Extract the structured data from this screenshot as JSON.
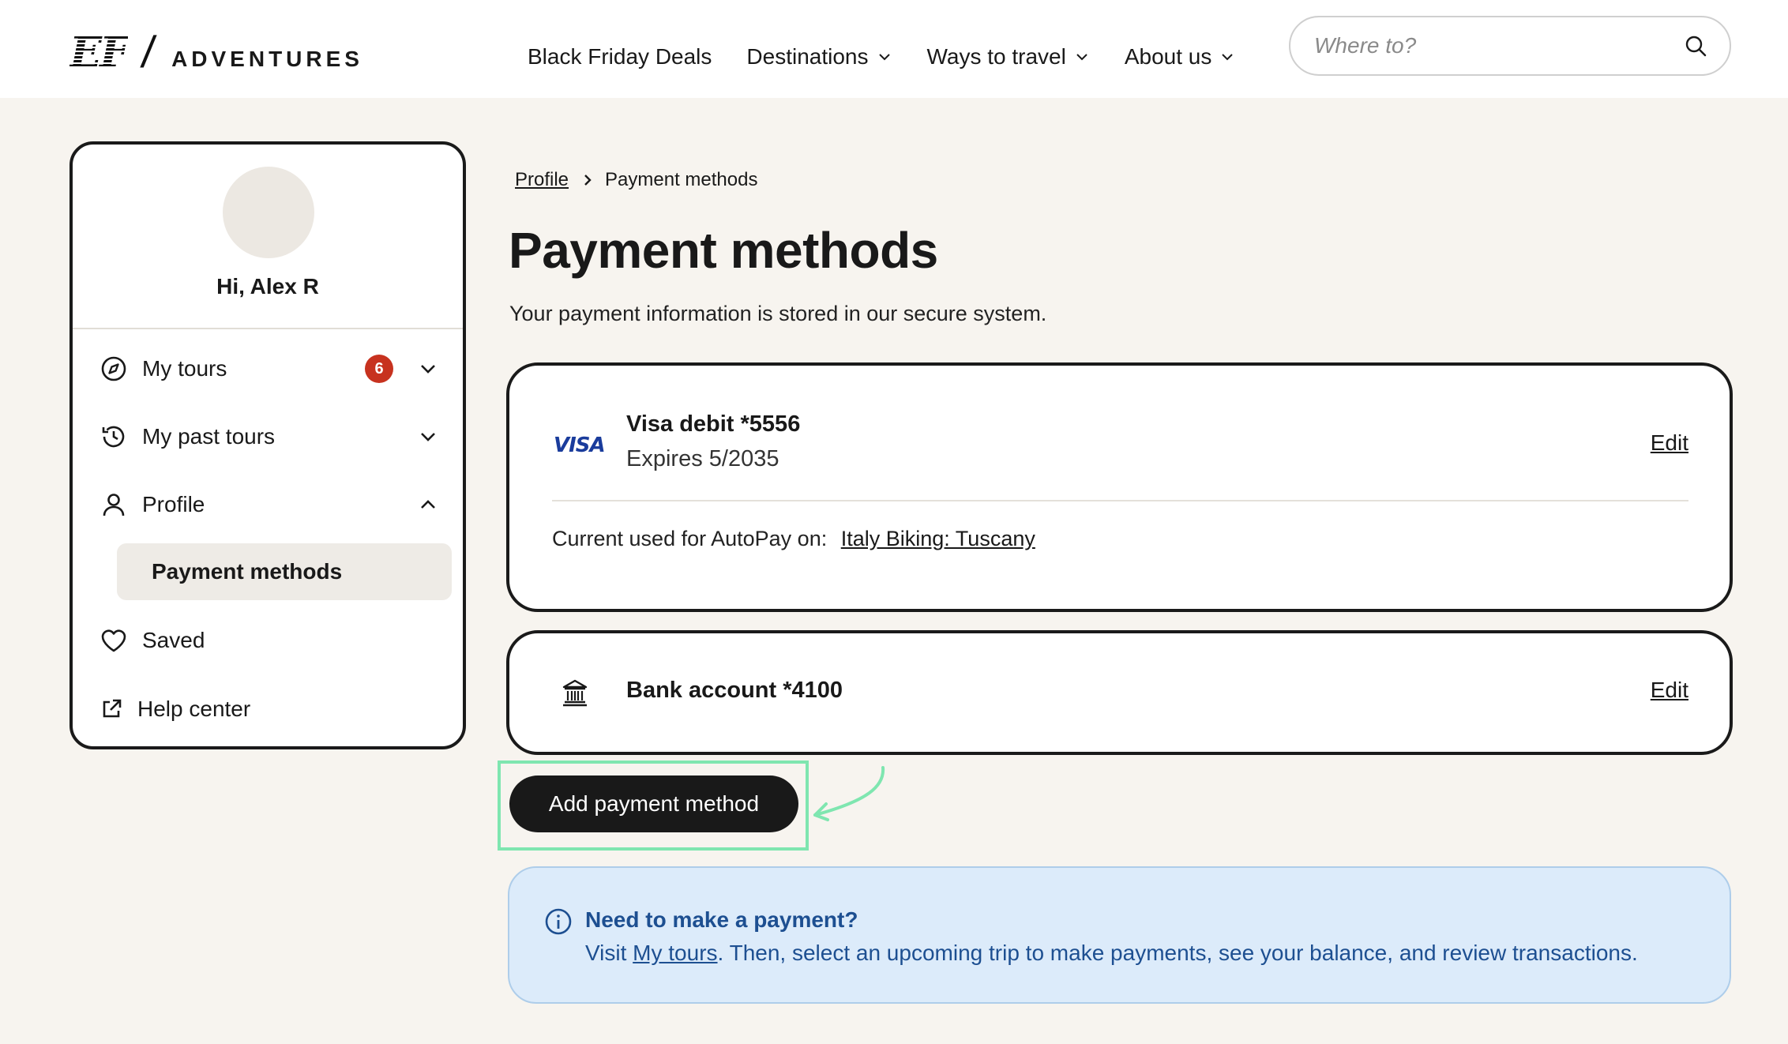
{
  "header": {
    "logo_mark": "EF",
    "logo_slash": "/",
    "logo_word": "ADVENTURES",
    "nav": [
      {
        "label": "Black Friday Deals",
        "dropdown": false
      },
      {
        "label": "Destinations",
        "dropdown": true
      },
      {
        "label": "Ways to travel",
        "dropdown": true
      },
      {
        "label": "About us",
        "dropdown": true
      }
    ],
    "search_placeholder": "Where to?"
  },
  "sidebar": {
    "greeting": "Hi, Alex R",
    "items": [
      {
        "label": "My tours",
        "icon": "compass-icon",
        "badge": "6",
        "chevron": "down"
      },
      {
        "label": "My past tours",
        "icon": "history-icon",
        "chevron": "down"
      },
      {
        "label": "Profile",
        "icon": "user-icon",
        "chevron": "up"
      },
      {
        "label": "Saved",
        "icon": "heart-icon"
      },
      {
        "label": "Help center",
        "icon": "external-link-icon"
      }
    ],
    "sub_item": "Payment methods"
  },
  "breadcrumb": {
    "parent": "Profile",
    "current": "Payment methods"
  },
  "main": {
    "title": "Payment methods",
    "subtitle": "Your payment information is stored in our secure system.",
    "cards": [
      {
        "brand": "VISA",
        "title": "Visa debit *5556",
        "expires": "Expires 5/2035",
        "edit": "Edit",
        "autopay_label": "Current used for AutoPay on:",
        "autopay_link": "Italy Biking: Tuscany"
      },
      {
        "icon": "bank-icon",
        "title": "Bank account *4100",
        "edit": "Edit"
      }
    ],
    "add_button": "Add payment method"
  },
  "info": {
    "title": "Need to make a payment?",
    "body_prefix": "Visit ",
    "body_link": "My tours",
    "body_suffix": ". Then, select an upcoming trip to make payments, see your balance, and review transactions."
  },
  "colors": {
    "background": "#f7f4ef",
    "badge": "#c7321f",
    "info_bg": "#dcebfa",
    "info_text": "#1d4f91",
    "highlight": "#7fe6b0"
  }
}
